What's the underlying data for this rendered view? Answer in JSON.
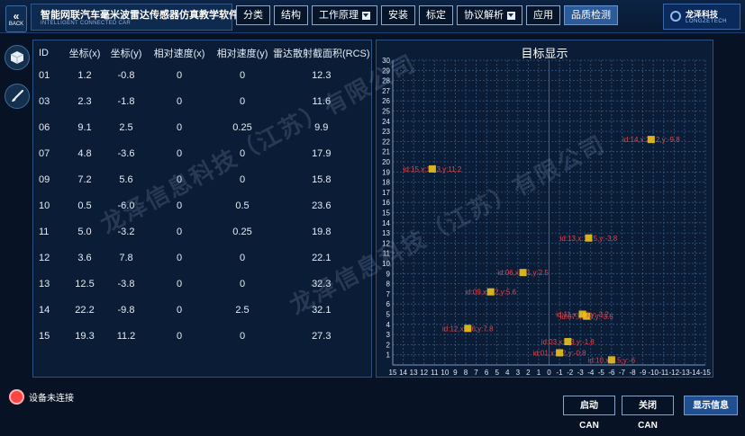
{
  "header": {
    "back_label": "BACK",
    "title": "智能网联汽车毫米波雷达传感器仿真教学软件",
    "subtitle": "INTELLIGENT CONNECTED CAR",
    "nav": [
      {
        "label": "分类"
      },
      {
        "label": "结构"
      },
      {
        "label": "工作原理"
      },
      {
        "label": "安装"
      },
      {
        "label": "标定"
      },
      {
        "label": "协议解析"
      },
      {
        "label": "应用"
      },
      {
        "label": "品质检测"
      }
    ],
    "brand_cn": "龙泽科技",
    "brand_en": "LONGZETECH"
  },
  "table": {
    "headers": [
      "ID",
      "坐标(x)",
      "坐标(y)",
      "相对速度(x)",
      "相对速度(y)",
      "雷达散射截面积(RCS)"
    ],
    "rows": [
      [
        "01",
        "1.2",
        "-0.8",
        "0",
        "0",
        "12.3"
      ],
      [
        "03",
        "2.3",
        "-1.8",
        "0",
        "0",
        "11.6"
      ],
      [
        "06",
        "9.1",
        "2.5",
        "0",
        "0.25",
        "9.9"
      ],
      [
        "07",
        "4.8",
        "-3.6",
        "0",
        "0",
        "17.9"
      ],
      [
        "09",
        "7.2",
        "5.6",
        "0",
        "0",
        "15.8"
      ],
      [
        "10",
        "0.5",
        "-6.0",
        "0",
        "0.5",
        "23.6"
      ],
      [
        "11",
        "5.0",
        "-3.2",
        "0",
        "0.25",
        "19.8"
      ],
      [
        "12",
        "3.6",
        "7.8",
        "0",
        "0",
        "22.1"
      ],
      [
        "13",
        "12.5",
        "-3.8",
        "0",
        "0",
        "32.3"
      ],
      [
        "14",
        "22.2",
        "-9.8",
        "0",
        "2.5",
        "32.1"
      ],
      [
        "15",
        "19.3",
        "11.2",
        "0",
        "0",
        "27.3"
      ]
    ]
  },
  "chart_title": "目标显示",
  "chart_data": {
    "type": "scatter",
    "title": "目标显示",
    "x_ticks": [
      15,
      14,
      13,
      12,
      11,
      10,
      9,
      8,
      7,
      6,
      5,
      4,
      3,
      2,
      1,
      0,
      -1,
      -2,
      -3,
      -4,
      -5,
      -6,
      -7,
      -8,
      -9,
      -10,
      -11,
      -12,
      -13,
      -14,
      -15
    ],
    "y_ticks": [
      1,
      2,
      3,
      4,
      5,
      6,
      7,
      8,
      9,
      10,
      11,
      12,
      13,
      14,
      15,
      16,
      17,
      18,
      19,
      20,
      21,
      22,
      23,
      24,
      25,
      26,
      27,
      28,
      29,
      30
    ],
    "xlim": [
      15,
      -15
    ],
    "ylim": [
      0,
      30
    ],
    "grid": true,
    "points": [
      {
        "label": "id:01,x:1.2,y:-0.8",
        "id": "01",
        "x": 1.2,
        "y": -0.8,
        "box_x": -1,
        "box_y": 1.2
      },
      {
        "label": "id:03,x:2.3,y:-1.8",
        "id": "03",
        "x": 2.3,
        "y": -1.8,
        "box_x": -1.8,
        "box_y": 2.3
      },
      {
        "label": "id:06,x:9.1,y:2.5",
        "id": "06",
        "x": 9.1,
        "y": 2.5,
        "box_x": 2.5,
        "box_y": 9.1
      },
      {
        "label": "id:07,x:4.8,y:-3.6",
        "id": "07",
        "x": 4.8,
        "y": -3.6,
        "box_x": -3.6,
        "box_y": 4.8
      },
      {
        "label": "id:09,x:7.2,y:5.6",
        "id": "09",
        "x": 7.2,
        "y": 5.6,
        "box_x": 5.6,
        "box_y": 7.2
      },
      {
        "label": "id:10,x:0.5,y:-6",
        "id": "10",
        "x": 0.5,
        "y": -6.0,
        "box_x": -6,
        "box_y": 0.5
      },
      {
        "label": "id:11,x:5.0,y:-3.2",
        "id": "11",
        "x": 5.0,
        "y": -3.2,
        "box_x": -3.2,
        "box_y": 5.0
      },
      {
        "label": "id:12,x:3.6,y:7.8",
        "id": "12",
        "x": 3.6,
        "y": 7.8,
        "box_x": 7.8,
        "box_y": 3.6
      },
      {
        "label": "id:13,x:12.5,y:-3.8",
        "id": "13",
        "x": 12.5,
        "y": -3.8,
        "box_x": -3.8,
        "box_y": 12.5
      },
      {
        "label": "id:14,x:22.2,y:-9.8",
        "id": "14",
        "x": 22.2,
        "y": -9.8,
        "box_x": -9.8,
        "box_y": 22.2
      },
      {
        "label": "id:15,x:19.3,y:11.2",
        "id": "15",
        "x": 19.3,
        "y": 11.2,
        "box_x": 11.2,
        "box_y": 19.3
      }
    ],
    "colors": {
      "grid": "#33577f",
      "center_line": "#c0313b",
      "label": "#e0454f",
      "marker": "#e8c21a"
    }
  },
  "status": {
    "text": "设备未连接",
    "color": "#ff4444"
  },
  "buttons": {
    "start": "启动CAN",
    "stop": "关闭CAN",
    "show": "显示信息"
  },
  "watermark": "龙泽信息科技（江苏）有限公司"
}
